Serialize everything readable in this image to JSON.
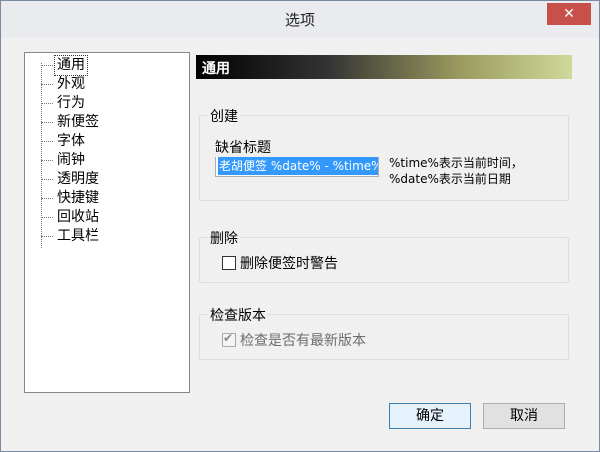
{
  "window": {
    "title": "选项",
    "close_glyph": "✕"
  },
  "nav": {
    "items": [
      "通用",
      "外观",
      "行为",
      "新便签",
      "字体",
      "闹钟",
      "透明度",
      "快捷键",
      "回收站",
      "工具栏"
    ],
    "selected_index": 0
  },
  "page": {
    "header": "通用",
    "header_gradient": [
      "#000000",
      "#cfd99a"
    ],
    "create": {
      "title": "创建",
      "default_title_label": "缺省标题",
      "default_title_value": "老胡便签 %date% - %time%",
      "hint_line1": "%time%表示当前时间，",
      "hint_line2": "%date%表示当前日期"
    },
    "delete": {
      "title": "删除",
      "warn_label": "删除便签时警告",
      "warn_checked": false
    },
    "check_version": {
      "title": "检查版本",
      "check_label": "检查是否有最新版本",
      "check_checked": true,
      "check_enabled": false
    }
  },
  "buttons": {
    "ok": "确定",
    "cancel": "取消"
  }
}
